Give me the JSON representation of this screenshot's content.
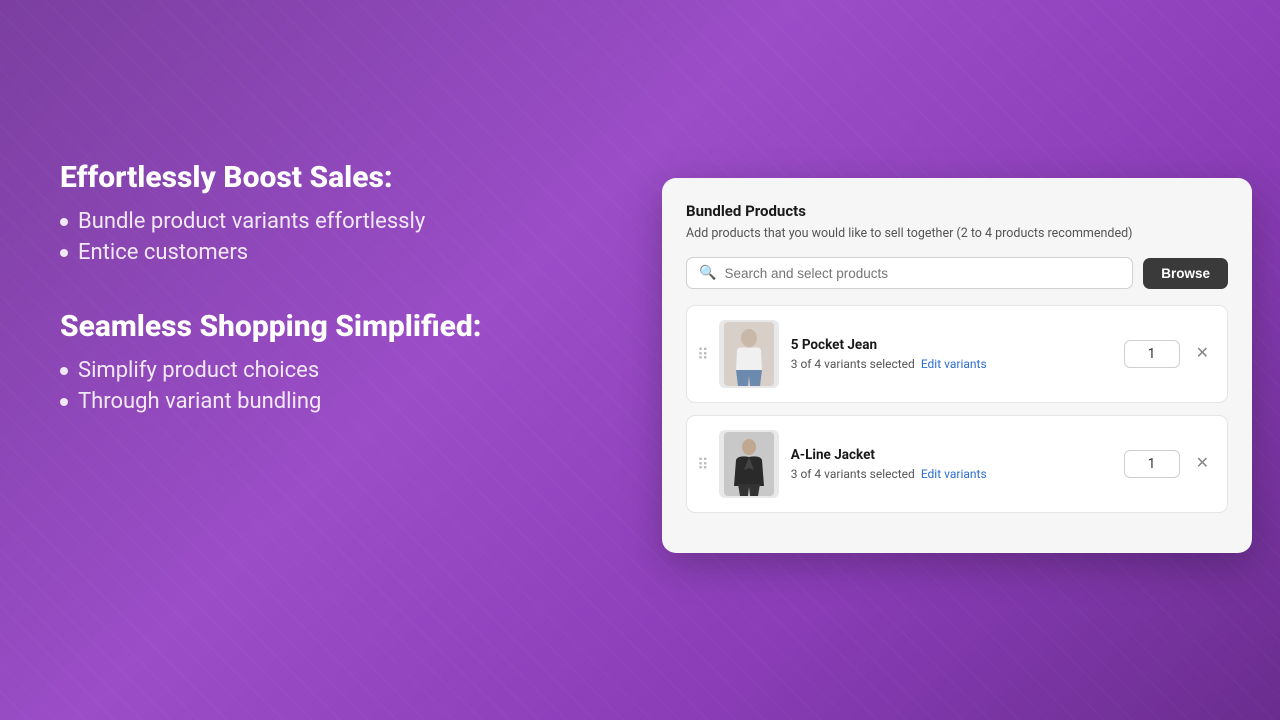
{
  "left": {
    "section1": {
      "headline": "Effortlessly Boost Sales:",
      "bullets": [
        "Bundle product variants effortlessly",
        "Entice customers"
      ]
    },
    "section2": {
      "headline": "Seamless Shopping Simplified:",
      "bullets": [
        "Simplify product choices",
        "Through variant bundling"
      ]
    }
  },
  "card": {
    "title": "Bundled Products",
    "subtitle": "Add products that you would like to sell together (2 to 4 products recommended)",
    "search": {
      "placeholder": "Search and select products",
      "browse_label": "Browse"
    },
    "products": [
      {
        "name": "5 Pocket Jean",
        "variants_text": "3 of 4 variants selected",
        "edit_label": "Edit variants",
        "qty": "1",
        "bg_color": "#d8cfc8",
        "figure_color": "#888"
      },
      {
        "name": "A-Line Jacket",
        "variants_text": "3 of 4 variants selected",
        "edit_label": "Edit variants",
        "qty": "1",
        "bg_color": "#c8c8c8",
        "figure_color": "#444"
      }
    ]
  }
}
